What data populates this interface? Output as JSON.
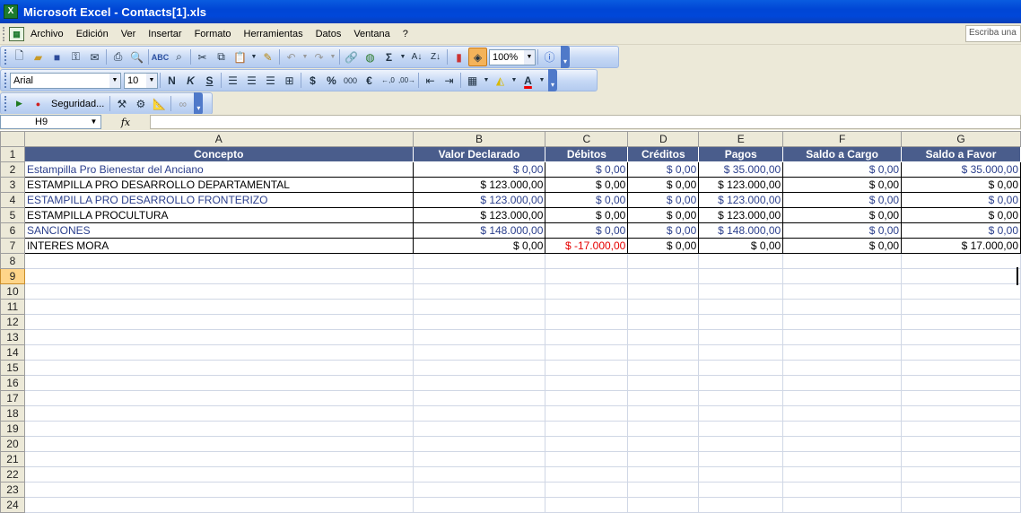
{
  "window": {
    "title": "Microsoft Excel - Contacts[1].xls",
    "app_icon": "X"
  },
  "menu": {
    "items": [
      "Archivo",
      "Edición",
      "Ver",
      "Insertar",
      "Formato",
      "Herramientas",
      "Datos",
      "Ventana",
      "?"
    ],
    "help_placeholder": "Escriba una"
  },
  "toolbar": {
    "zoom": "100%",
    "font_name": "Arial",
    "font_size": "10",
    "security_label": "Seguridad...",
    "sum_symbol": "Σ",
    "bold": "N",
    "italic": "K",
    "underline": "S",
    "currency": "$",
    "percent": "%",
    "thousands": "000",
    "euro": "€"
  },
  "formula_bar": {
    "name_box": "H9",
    "fx_label": "fx",
    "value": ""
  },
  "sheet": {
    "columns": [
      "A",
      "B",
      "C",
      "D",
      "E",
      "F",
      "G"
    ],
    "active_cell": "H9",
    "header_row": [
      "Concepto",
      "Valor Declarado",
      "Débitos",
      "Créditos",
      "Pagos",
      "Saldo a Cargo",
      "Saldo a Favor"
    ],
    "rows": [
      {
        "concepto": "Estampilla Pro Bienestar del Anciano",
        "valor": "$ 0,00",
        "debitos": "$ 0,00",
        "creditos": "$ 0,00",
        "pagos": "$ 35.000,00",
        "cargo": "$ 0,00",
        "favor": "$ 35.000,00",
        "text_color": "blue"
      },
      {
        "concepto": "ESTAMPILLA PRO DESARROLLO DEPARTAMENTAL",
        "valor": "$ 123.000,00",
        "debitos": "$ 0,00",
        "creditos": "$ 0,00",
        "pagos": "$ 123.000,00",
        "cargo": "$ 0,00",
        "favor": "$ 0,00",
        "text_color": "black"
      },
      {
        "concepto": "ESTAMPILLA PRO DESARROLLO FRONTERIZO",
        "valor": "$ 123.000,00",
        "debitos": "$ 0,00",
        "creditos": "$ 0,00",
        "pagos": "$ 123.000,00",
        "cargo": "$ 0,00",
        "favor": "$ 0,00",
        "text_color": "blue"
      },
      {
        "concepto": "ESTAMPILLA PROCULTURA",
        "valor": "$ 123.000,00",
        "debitos": "$ 0,00",
        "creditos": "$ 0,00",
        "pagos": "$ 123.000,00",
        "cargo": "$ 0,00",
        "favor": "$ 0,00",
        "text_color": "black"
      },
      {
        "concepto": "SANCIONES",
        "valor": "$ 148.000,00",
        "debitos": "$ 0,00",
        "creditos": "$ 0,00",
        "pagos": "$ 148.000,00",
        "cargo": "$ 0,00",
        "favor": "$ 0,00",
        "text_color": "blue"
      },
      {
        "concepto": "INTERES MORA",
        "valor": "$ 0,00",
        "debitos": "$ -17.000,00",
        "creditos": "$ 0,00",
        "pagos": "$ 0,00",
        "cargo": "$ 0,00",
        "favor": "$ 17.000,00",
        "text_color": "black",
        "debitos_color": "red"
      }
    ],
    "row_numbers": [
      "1",
      "2",
      "3",
      "4",
      "5",
      "6",
      "7",
      "8",
      "9",
      "10",
      "11",
      "12",
      "13",
      "14",
      "15",
      "16",
      "17",
      "18",
      "19",
      "20",
      "21",
      "22",
      "23",
      "24"
    ]
  },
  "colors": {
    "header_fill": "#4a5d8c",
    "header_text": "#ffffff",
    "blue_text": "#2b3f8c",
    "negative": "#e60000",
    "title_bar": "#0046d5"
  }
}
